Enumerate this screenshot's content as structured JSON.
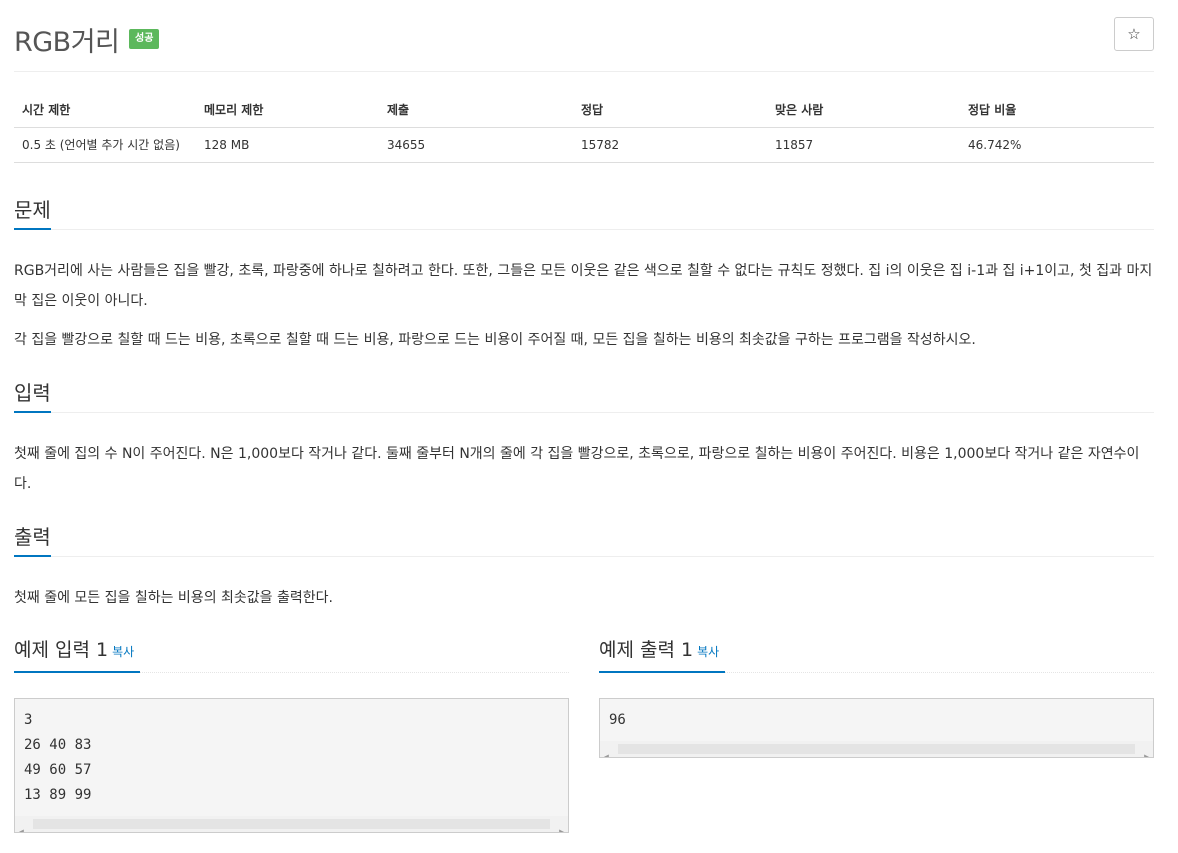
{
  "problem": {
    "title": "RGB거리",
    "badge": "성공",
    "star_icon": "☆"
  },
  "info": {
    "headers": [
      "시간 제한",
      "메모리 제한",
      "제출",
      "정답",
      "맞은 사람",
      "정답 비율"
    ],
    "values": [
      "0.5 초 (언어별 추가 시간 없음)",
      "128 MB",
      "34655",
      "15782",
      "11857",
      "46.742%"
    ]
  },
  "sections": {
    "problem_title": "문제",
    "problem_p1": "RGB거리에 사는 사람들은 집을 빨강, 초록, 파랑중에 하나로 칠하려고 한다. 또한, 그들은 모든 이웃은 같은 색으로 칠할 수 없다는 규칙도 정했다. 집 i의 이웃은 집 i-1과 집 i+1이고, 첫 집과 마지막 집은 이웃이 아니다.",
    "problem_p2": "각 집을 빨강으로 칠할 때 드는 비용, 초록으로 칠할 때 드는 비용, 파랑으로 드는 비용이 주어질 때, 모든 집을 칠하는 비용의 최솟값을 구하는 프로그램을 작성하시오.",
    "input_title": "입력",
    "input_p": "첫째 줄에 집의 수 N이 주어진다. N은 1,000보다 작거나 같다. 둘째 줄부터 N개의 줄에 각 집을 빨강으로, 초록으로, 파랑으로 칠하는 비용이 주어진다. 비용은 1,000보다 작거나 같은 자연수이다.",
    "output_title": "출력",
    "output_p": "첫째 줄에 모든 집을 칠하는 비용의 최솟값을 출력한다."
  },
  "samples": {
    "input_title": "예제 입력 1",
    "output_title": "예제 출력 1",
    "copy_label": "복사",
    "input_lines": [
      "3",
      "26 40 83",
      "49 60 57",
      "13 89 99"
    ],
    "output_lines": [
      "96"
    ]
  }
}
